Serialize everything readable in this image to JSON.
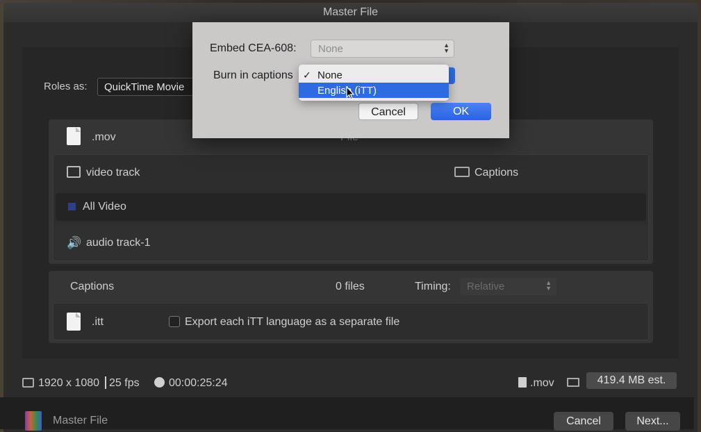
{
  "window": {
    "title": "Master File"
  },
  "roles": {
    "label": "Roles as:",
    "value": "QuickTime Movie"
  },
  "file_row": {
    "name": ".mov",
    "column_header": "File"
  },
  "video_track": {
    "label": "video track",
    "captions_label": "Captions"
  },
  "all_video": {
    "label": "All Video"
  },
  "audio_track": {
    "label": "audio track-1"
  },
  "captions_section": {
    "label": "Captions",
    "files": "0 files",
    "timing_label": "Timing:",
    "timing_value": "Relative"
  },
  "itt_row": {
    "name": ".itt",
    "export_checkbox_label": "Export each iTT language as a separate file",
    "export_checked": false
  },
  "status": {
    "resolution": "1920 x 1080",
    "fps": "25 fps",
    "duration": "00:00:25:24",
    "format": ".mov",
    "size_estimate": "419.4 MB est."
  },
  "bottom": {
    "preset_label": "Master File",
    "cancel": "Cancel",
    "next": "Next..."
  },
  "dialog": {
    "embed_label": "Embed CEA-608:",
    "embed_value": "None",
    "burn_label": "Burn in captions",
    "cancel": "Cancel",
    "ok": "OK",
    "menu": [
      {
        "label": "None",
        "checked": true,
        "highlighted": false
      },
      {
        "label": "English (iTT)",
        "checked": false,
        "highlighted": true
      }
    ]
  },
  "colors": {
    "accent": "#2f6be0",
    "all_video_swatch": "#2e3f8a"
  }
}
